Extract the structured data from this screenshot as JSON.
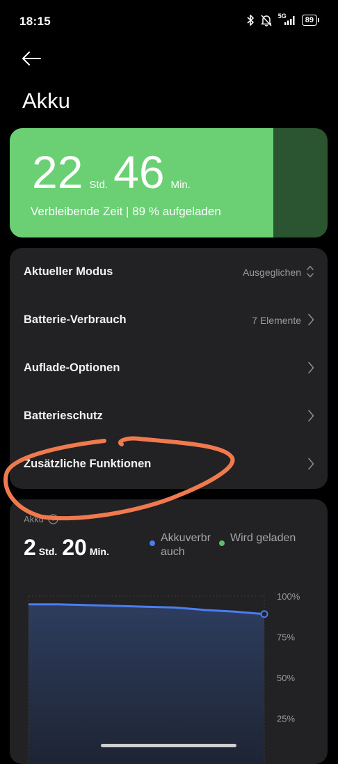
{
  "status": {
    "time": "18:15",
    "network": "5G",
    "battery": "89"
  },
  "header": {
    "back_icon": "arrow-left-icon",
    "title": "Akku"
  },
  "hero": {
    "hours": "22",
    "hours_unit": "Std.",
    "minutes": "46",
    "minutes_unit": "Min.",
    "subtitle": "Verbleibende Zeit | 89 % aufgeladen",
    "charge_level": 0.83,
    "fill_color": "#6bcf74",
    "empty_color": "#2b5530"
  },
  "settings": [
    {
      "label": "Aktueller Modus",
      "value": "Ausgeglichen",
      "icon": "chevron-up-down-icon"
    },
    {
      "label": "Batterie-Verbrauch",
      "value": "7 Elemente",
      "icon": "chevron-right-icon"
    },
    {
      "label": "Auflade-Optionen",
      "value": "",
      "icon": "chevron-right-icon"
    },
    {
      "label": "Batterieschutz",
      "value": "",
      "icon": "chevron-right-icon"
    },
    {
      "label": "Zusätzliche Funktionen",
      "value": "",
      "icon": "chevron-right-icon"
    }
  ],
  "usage": {
    "title": "Akku",
    "hours": "2",
    "hours_unit": "Std.",
    "minutes": "20",
    "minutes_unit": "Min.",
    "legend": [
      {
        "name": "Akkuverbr",
        "name2": "auch",
        "color": "#4a7ef0"
      },
      {
        "name": "Wird geladen",
        "color": "#5fc166"
      }
    ]
  },
  "chart_data": {
    "type": "area",
    "y_tick_labels": [
      "100%",
      "75%",
      "50%",
      "25%"
    ],
    "ylim": [
      0,
      100
    ],
    "series": [
      {
        "values": [
          95,
          95,
          94.5,
          94,
          93.5,
          93,
          91.5,
          90.5,
          89
        ]
      }
    ],
    "line_color": "#4a7ef0",
    "grid": true
  },
  "annotation": {
    "color": "#f07a4e",
    "target": "Zusätzliche Funktionen"
  }
}
